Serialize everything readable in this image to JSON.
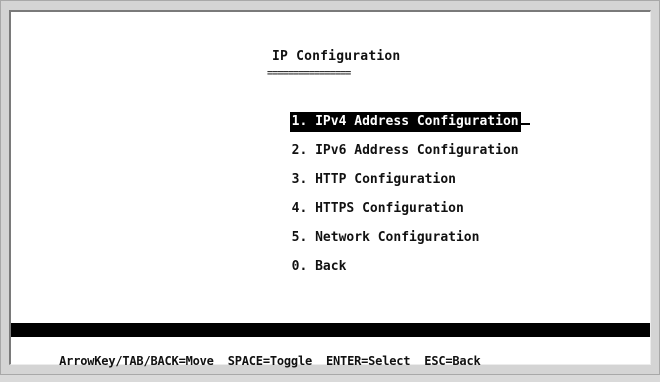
{
  "screen": {
    "title": "IP Configuration",
    "title_underline": "================"
  },
  "menu": {
    "items": [
      {
        "label": "1. IPv4 Address Configuration",
        "selected": true
      },
      {
        "label": "2. IPv6 Address Configuration",
        "selected": false
      },
      {
        "label": "3. HTTP Configuration",
        "selected": false
      },
      {
        "label": "4. HTTPS Configuration",
        "selected": false
      },
      {
        "label": "5. Network Configuration",
        "selected": false
      },
      {
        "label": "0. Back",
        "selected": false
      }
    ]
  },
  "help": {
    "move": "ArrowKey/TAB/BACK=Move",
    "toggle": "SPACE=Toggle",
    "select": "ENTER=Select",
    "back": "ESC=Back"
  },
  "colors": {
    "background": "#ffffff",
    "text": "#111111",
    "highlight_bg": "#000000",
    "highlight_text": "#ffffff"
  }
}
